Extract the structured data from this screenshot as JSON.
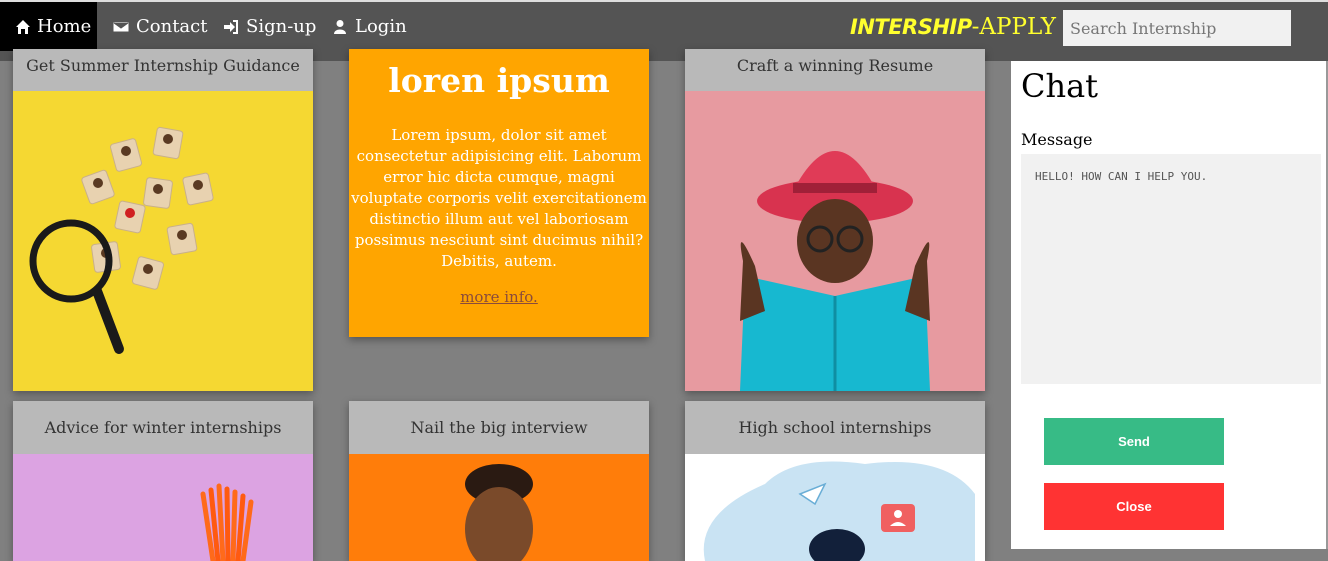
{
  "nav": {
    "home": "Home",
    "contact": "Contact",
    "signup": "Sign-up",
    "login": "Login"
  },
  "brand": {
    "strong": "INTERSHIP",
    "rest": "-APPLY"
  },
  "search": {
    "placeholder": "Search Internship"
  },
  "cards": {
    "guidance": "Get Summer Internship Guidance",
    "resume": "Craft a winning Resume",
    "winter": "Advice for winter internships",
    "interview": "Nail the big interview",
    "highschool": "High school internships"
  },
  "promo": {
    "title": "loren ipsum",
    "body": "Lorem ipsum, dolor sit amet consectetur adipisicing elit. Laborum error hic dicta cumque, magni voluptate corporis velit exercitationem distinctio illum aut vel laboriosam possimus nesciunt sint ducimus nihil? Debitis, autem.",
    "link": "more info."
  },
  "chat": {
    "title": "Chat",
    "message_label": "Message",
    "message_value": "HELLO! HOW CAN I HELP YOU.",
    "send": "Send",
    "close": "Close"
  },
  "colors": {
    "nav_bg": "#545454",
    "brand": "#ffff2e",
    "promo_bg": "#ffa500",
    "send": "#37bb86",
    "close": "#ff3333"
  }
}
